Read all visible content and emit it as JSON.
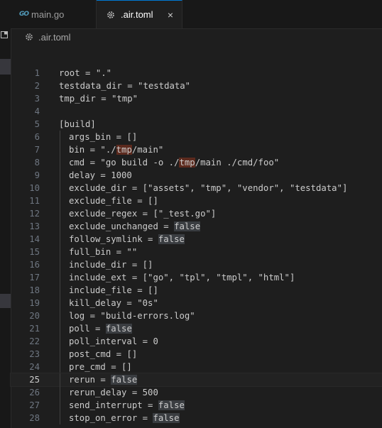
{
  "tabs": [
    {
      "label": "main.go",
      "icon": "go-icon",
      "active": false
    },
    {
      "label": ".air.toml",
      "icon": "gear-icon",
      "active": true,
      "close": "×"
    }
  ],
  "breadcrumb": {
    "label": ".air.toml",
    "icon": "gear-icon"
  },
  "go_icon_text": "GO",
  "colors": {
    "background": "#1e1e1e",
    "tab_active_border": "#0078d4",
    "line_number": "#6e7681",
    "text": "#cccccc",
    "match_highlight": "#5c2a1e",
    "false_highlight": "#3a3d41"
  },
  "editor": {
    "current_line": 25,
    "lines": [
      {
        "n": "1",
        "indent": false,
        "segments": [
          {
            "t": "root = \".\""
          }
        ]
      },
      {
        "n": "2",
        "indent": false,
        "segments": [
          {
            "t": "testdata_dir = \"testdata\""
          }
        ]
      },
      {
        "n": "3",
        "indent": false,
        "segments": [
          {
            "t": "tmp_dir = \"tmp\""
          }
        ]
      },
      {
        "n": "4",
        "indent": false,
        "segments": [
          {
            "t": ""
          }
        ]
      },
      {
        "n": "5",
        "indent": false,
        "segments": [
          {
            "t": "[build]"
          }
        ]
      },
      {
        "n": "6",
        "indent": true,
        "segments": [
          {
            "t": "args_bin = []"
          }
        ]
      },
      {
        "n": "7",
        "indent": true,
        "segments": [
          {
            "t": "bin = \"./"
          },
          {
            "t": "tmp",
            "hl": "red"
          },
          {
            "t": "/main\""
          }
        ]
      },
      {
        "n": "8",
        "indent": true,
        "segments": [
          {
            "t": "cmd = \"go build -o ./"
          },
          {
            "t": "tmp",
            "hl": "red"
          },
          {
            "t": "/main ./cmd/foo\""
          }
        ]
      },
      {
        "n": "9",
        "indent": true,
        "segments": [
          {
            "t": "delay = 1000"
          }
        ]
      },
      {
        "n": "10",
        "indent": true,
        "segments": [
          {
            "t": "exclude_dir = [\"assets\", \"tmp\", \"vendor\", \"testdata\"]"
          }
        ]
      },
      {
        "n": "11",
        "indent": true,
        "segments": [
          {
            "t": "exclude_file = []"
          }
        ]
      },
      {
        "n": "12",
        "indent": true,
        "segments": [
          {
            "t": "exclude_regex = [\"_test.go\"]"
          }
        ]
      },
      {
        "n": "13",
        "indent": true,
        "segments": [
          {
            "t": "exclude_unchanged = "
          },
          {
            "t": "false",
            "hl": "grey"
          }
        ]
      },
      {
        "n": "14",
        "indent": true,
        "segments": [
          {
            "t": "follow_symlink = "
          },
          {
            "t": "false",
            "hl": "grey"
          }
        ]
      },
      {
        "n": "15",
        "indent": true,
        "segments": [
          {
            "t": "full_bin = \"\""
          }
        ]
      },
      {
        "n": "16",
        "indent": true,
        "segments": [
          {
            "t": "include_dir = []"
          }
        ]
      },
      {
        "n": "17",
        "indent": true,
        "segments": [
          {
            "t": "include_ext = [\"go\", \"tpl\", \"tmpl\", \"html\"]"
          }
        ]
      },
      {
        "n": "18",
        "indent": true,
        "segments": [
          {
            "t": "include_file = []"
          }
        ]
      },
      {
        "n": "19",
        "indent": true,
        "segments": [
          {
            "t": "kill_delay = \"0s\""
          }
        ]
      },
      {
        "n": "20",
        "indent": true,
        "segments": [
          {
            "t": "log = \"build-errors.log\""
          }
        ]
      },
      {
        "n": "21",
        "indent": true,
        "segments": [
          {
            "t": "poll = "
          },
          {
            "t": "false",
            "hl": "grey"
          }
        ]
      },
      {
        "n": "22",
        "indent": true,
        "segments": [
          {
            "t": "poll_interval = 0"
          }
        ]
      },
      {
        "n": "23",
        "indent": true,
        "segments": [
          {
            "t": "post_cmd = []"
          }
        ]
      },
      {
        "n": "24",
        "indent": true,
        "segments": [
          {
            "t": "pre_cmd = []"
          }
        ]
      },
      {
        "n": "25",
        "indent": true,
        "segments": [
          {
            "t": "rerun = "
          },
          {
            "t": "false",
            "hl": "grey"
          }
        ]
      },
      {
        "n": "26",
        "indent": true,
        "segments": [
          {
            "t": "rerun_delay = 500"
          }
        ]
      },
      {
        "n": "27",
        "indent": true,
        "segments": [
          {
            "t": "send_interrupt = "
          },
          {
            "t": "false",
            "hl": "grey"
          }
        ]
      },
      {
        "n": "28",
        "indent": true,
        "segments": [
          {
            "t": "stop_on_error = "
          },
          {
            "t": "false",
            "hl": "grey"
          }
        ]
      }
    ]
  }
}
